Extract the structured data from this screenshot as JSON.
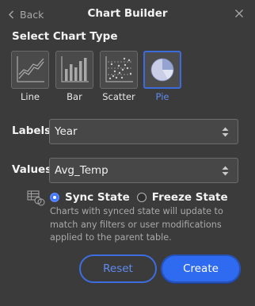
{
  "header": {
    "back_label": "Back",
    "title": "Chart Builder"
  },
  "chart_type": {
    "section_title": "Select Chart Type",
    "options": [
      {
        "label": "Line",
        "icon": "line-chart-icon",
        "selected": false
      },
      {
        "label": "Bar",
        "icon": "bar-chart-icon",
        "selected": false
      },
      {
        "label": "Scatter",
        "icon": "scatter-chart-icon",
        "selected": false
      },
      {
        "label": "Pie",
        "icon": "pie-chart-icon",
        "selected": true
      }
    ]
  },
  "labels_field": {
    "label": "Labels",
    "value": "Year"
  },
  "values_field": {
    "label": "Values",
    "value": "Avg_Temp"
  },
  "state": {
    "sync_label": "Sync State",
    "freeze_label": "Freeze State",
    "selected": "sync",
    "help_text": "Charts with synced state will update to match any filters or user modifications applied to the parent table."
  },
  "buttons": {
    "reset": "Reset",
    "create": "Create"
  },
  "colors": {
    "accent": "#3e6bdb",
    "accent_text": "#5f8cf0",
    "background": "#3b3b3b",
    "create_button": "#2f6bf1"
  }
}
